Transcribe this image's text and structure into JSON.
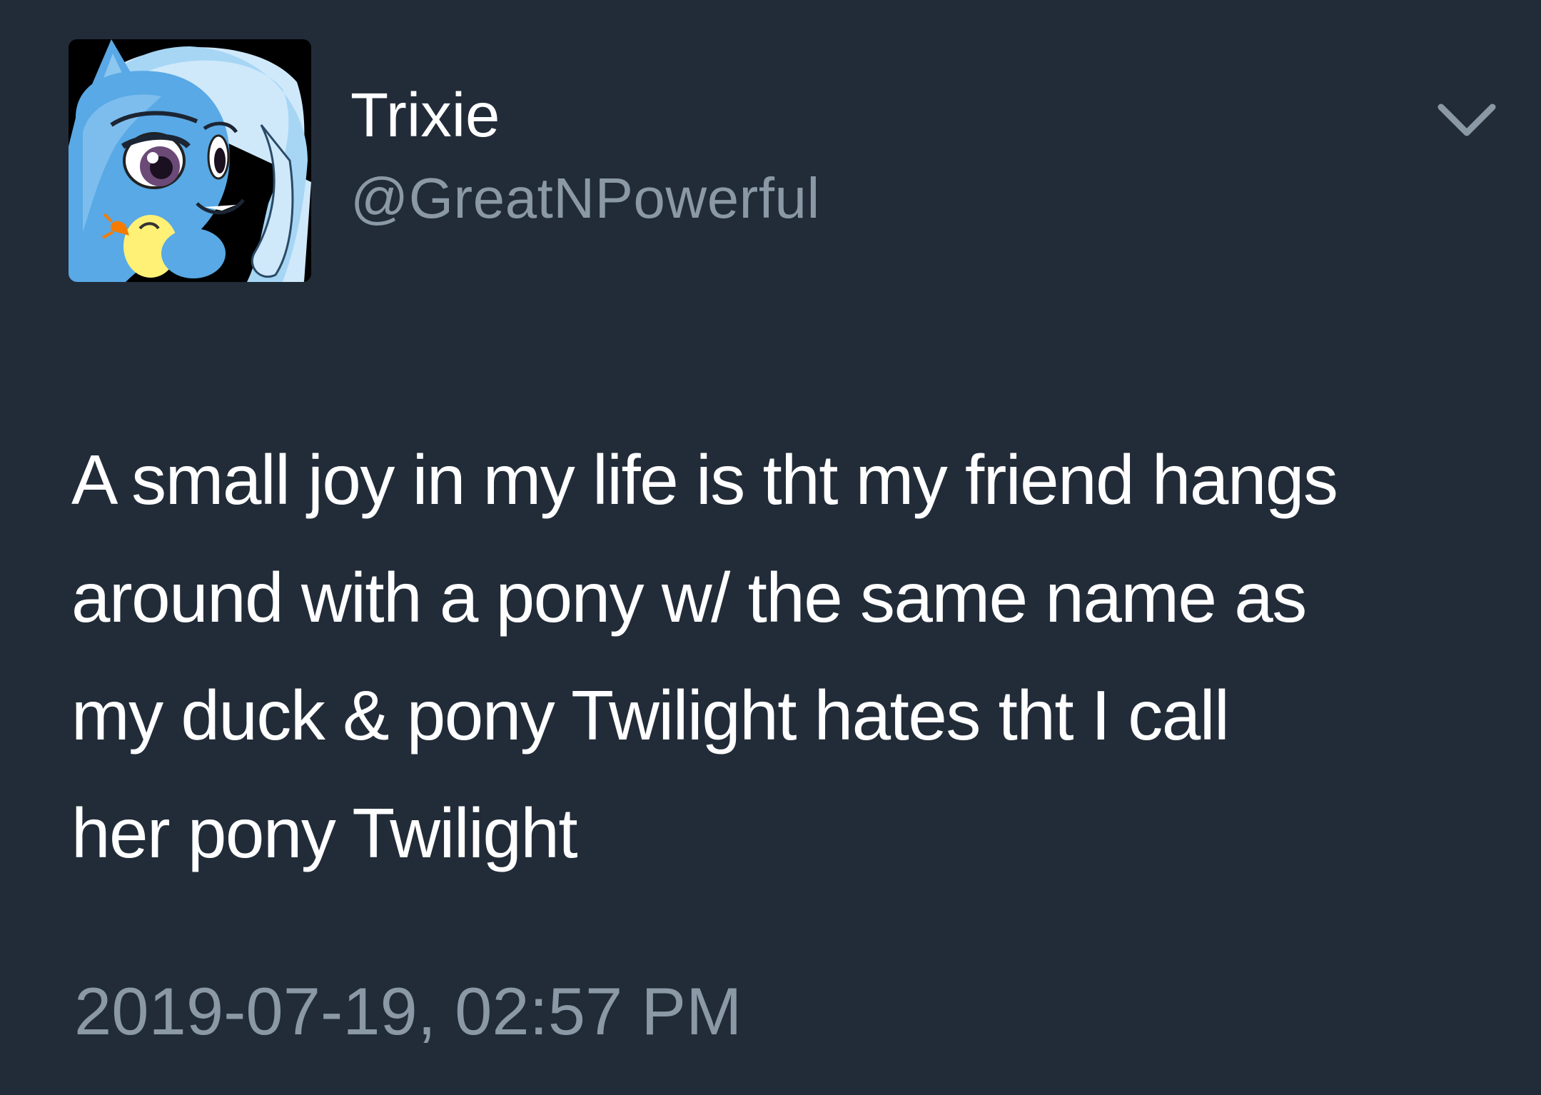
{
  "tweet": {
    "display_name": "Trixie",
    "handle": "@GreatNPowerful",
    "text": "A small joy in my life is tht my friend hangs\naround with a pony w/ the same name as\nmy duck & pony Twilight hates tht I call\nher pony Twilight",
    "timestamp": "2019-07-19, 02:57 PM"
  },
  "icons": {
    "more": "chevron-down-icon",
    "avatar": "avatar"
  },
  "colors": {
    "background": "#222c39",
    "primary_text": "#ffffff",
    "secondary_text": "#8b98a5"
  }
}
